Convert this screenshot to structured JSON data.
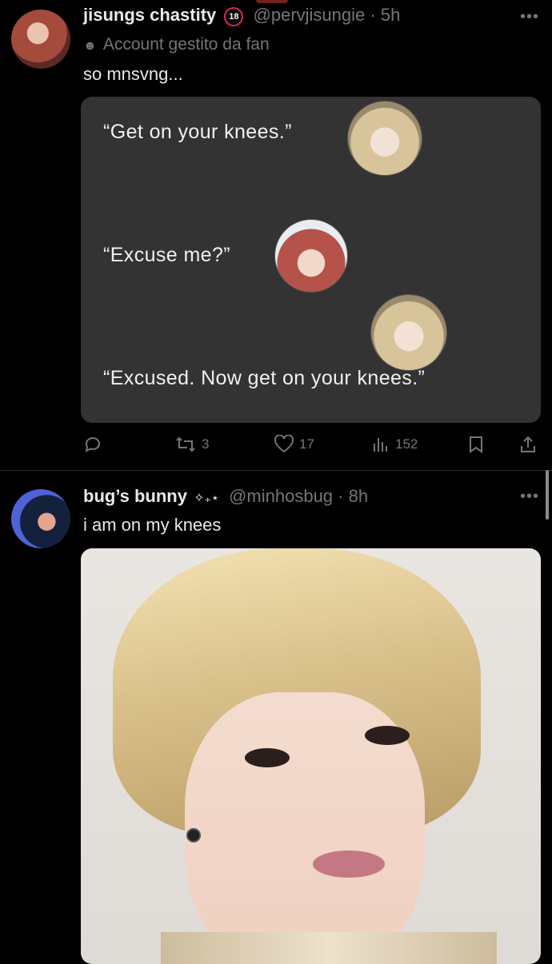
{
  "tweets": [
    {
      "display_name": "jisungs chastity",
      "badge": "18",
      "handle": "@pervjisungie",
      "separator": "·",
      "time": "5h",
      "fan_label": "Account gestito da fan",
      "text": "so mnsvng...",
      "card": {
        "lines": [
          "“Get on your knees.”",
          "“Excuse me?”",
          "“Excused. Now get on your knees.”"
        ]
      },
      "actions": {
        "replies": "",
        "retweets": "3",
        "likes": "17",
        "views": "152"
      }
    },
    {
      "display_name": "bug’s bunny",
      "sparkles": "✧₊⋆",
      "handle": "@minhosbug",
      "separator": "·",
      "time": "8h",
      "text": "i am on my knees"
    }
  ],
  "icons": {
    "more": "more-dots-icon",
    "reply": "reply-icon",
    "retweet": "retweet-icon",
    "like": "heart-icon",
    "views": "views-icon",
    "bookmark": "bookmark-icon",
    "share": "share-icon",
    "fan": "mask-icon"
  },
  "colors": {
    "background": "#000000",
    "card": "#333333",
    "muted": "#71767b",
    "badge": "#e0245e"
  }
}
